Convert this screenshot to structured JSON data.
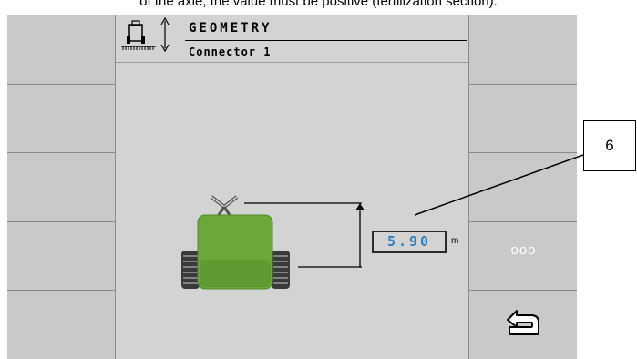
{
  "caption": "of the axle, the value must be positive (fertilization section).",
  "header": {
    "title": "GEOMETRY",
    "subtitle": "Connector 1"
  },
  "field": {
    "value": "5.90",
    "unit": "m"
  },
  "softkeys_right": {
    "more_label": "ooo"
  },
  "callout": {
    "label": "6"
  },
  "colors": {
    "value_text": "#2c7fc2",
    "machine_body": "#6aa83a",
    "background": "#bdbdbd"
  },
  "icons": [
    "machine-geometry-icon",
    "height-arrow-icon",
    "back-icon"
  ]
}
